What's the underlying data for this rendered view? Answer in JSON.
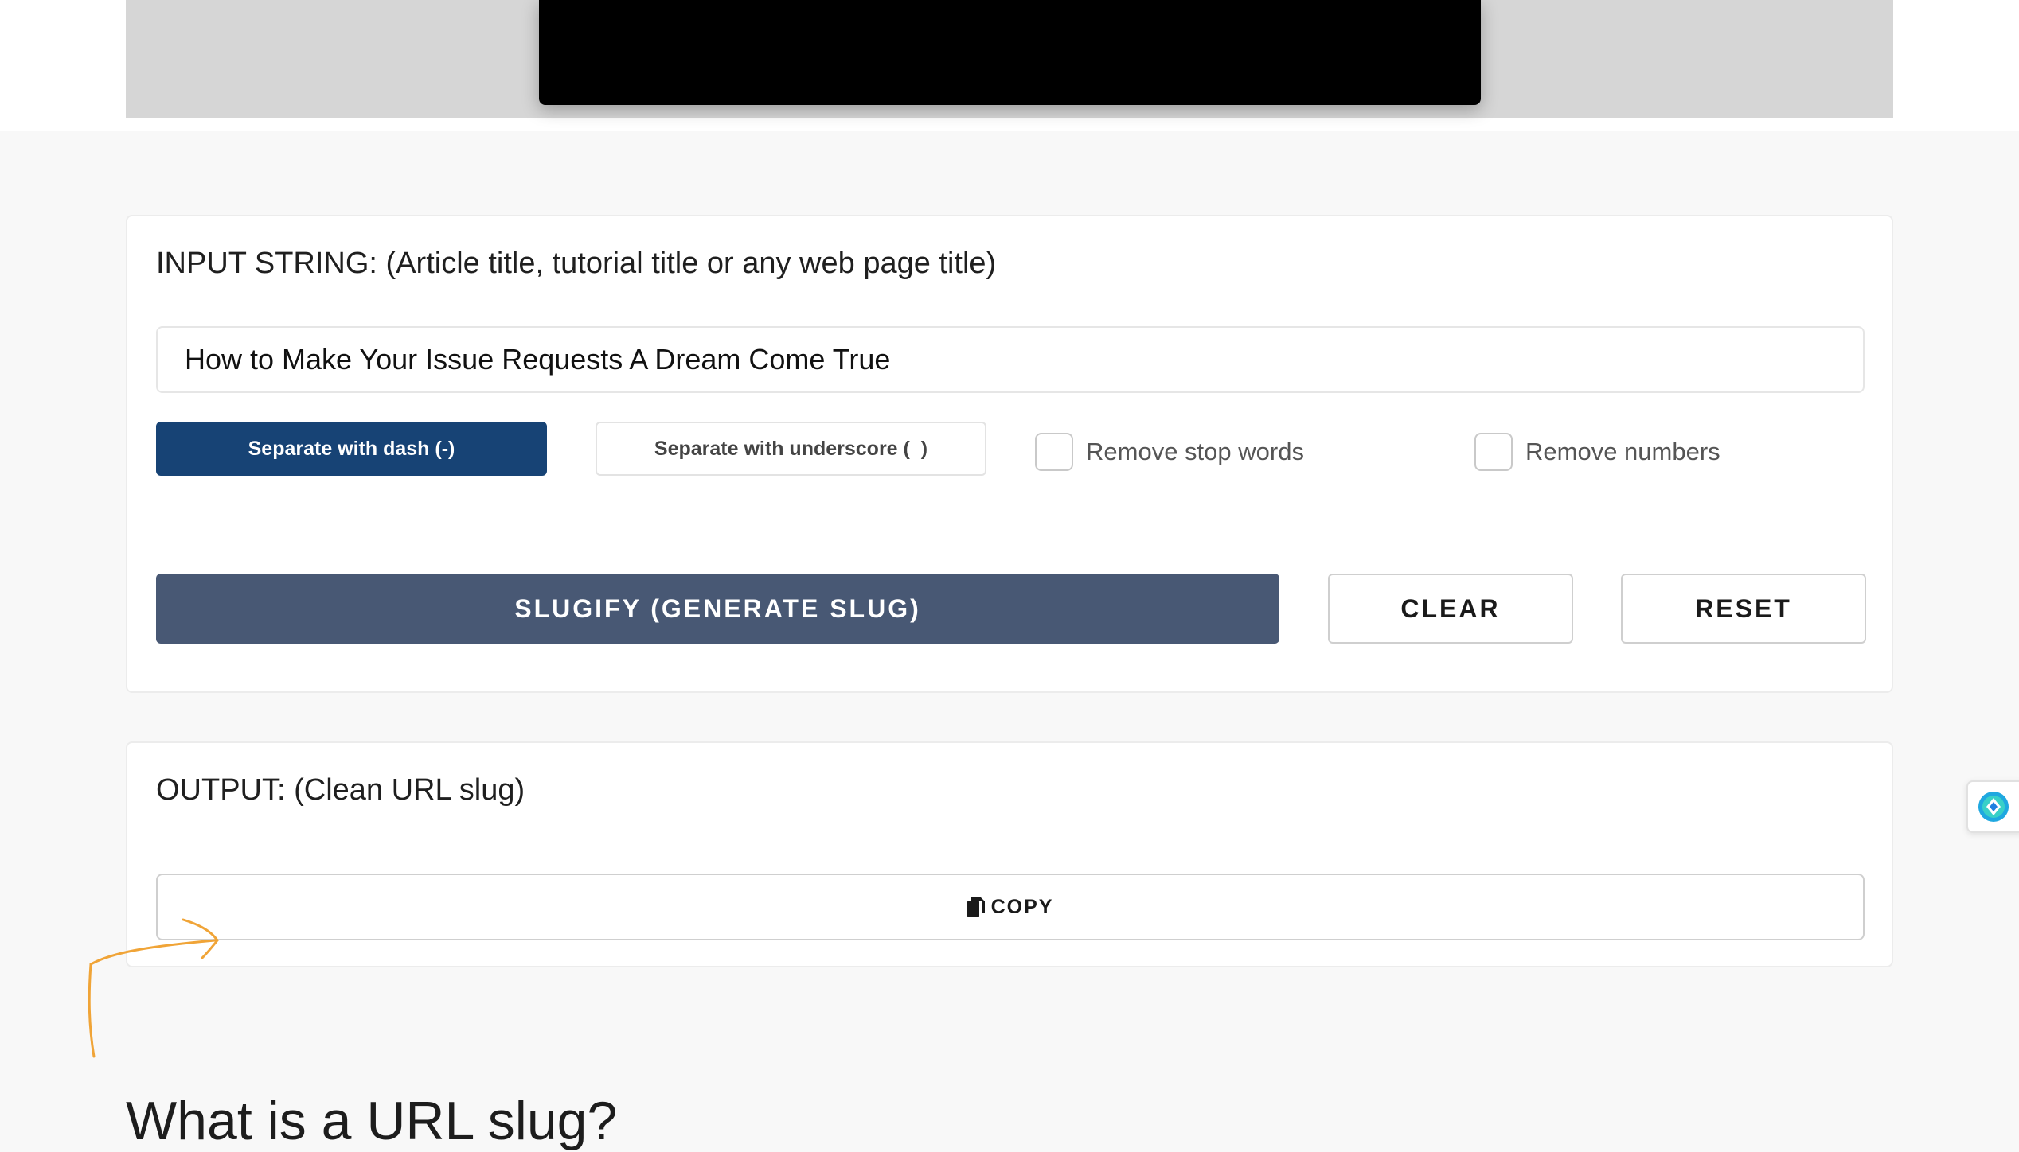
{
  "input_section": {
    "label": "INPUT STRING: (Article title, tutorial title or any web page title)",
    "input_value": "How to Make Your Issue Requests A Dream Come True",
    "separator_options": {
      "dash_label": "Separate with dash (-)",
      "underscore_label": "Separate with underscore (_)",
      "selected": "dash"
    },
    "checkboxes": {
      "stop_words_label": "Remove stop words",
      "numbers_label": "Remove numbers"
    },
    "buttons": {
      "slugify_label": "SLUGIFY (GENERATE SLUG)",
      "clear_label": "CLEAR",
      "reset_label": "RESET"
    }
  },
  "output_section": {
    "label": "OUTPUT: (Clean URL slug)",
    "copy_label": "COPY",
    "copy_icon": "copy-icon"
  },
  "article": {
    "heading": "What is a URL slug?"
  },
  "colors": {
    "primary_selected": "#174375",
    "slugify_bg": "#485874",
    "annotation_arrow": "#f0a437",
    "widget_accent": "#1fa8e0"
  }
}
